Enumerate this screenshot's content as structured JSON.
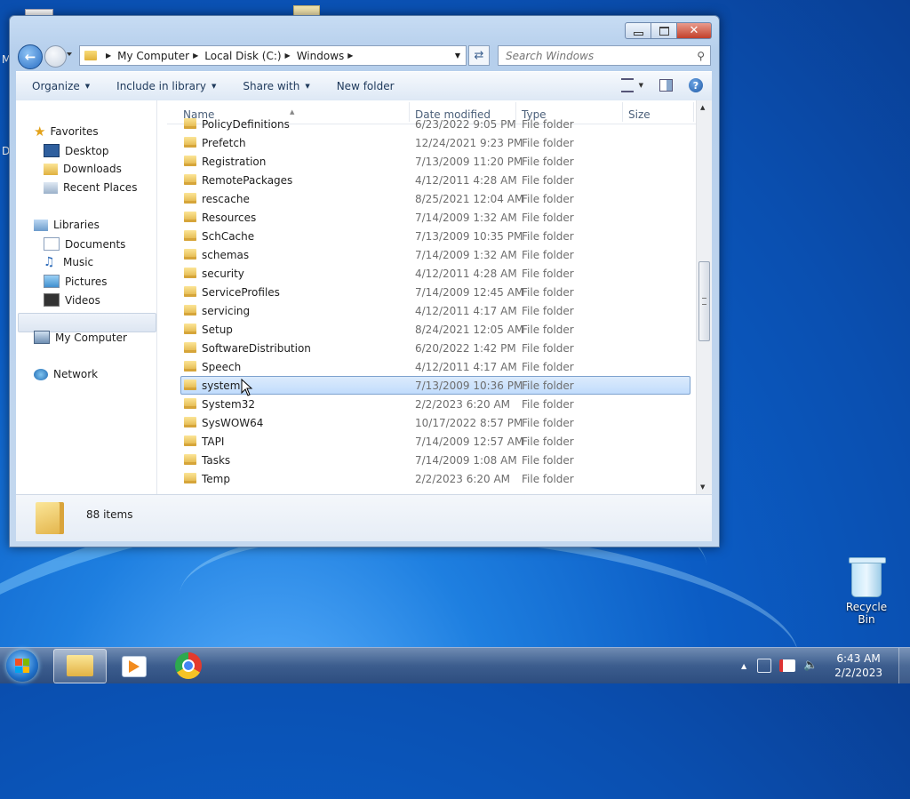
{
  "desktop": {
    "edge_letter_1": "M",
    "edge_letter_2": "D",
    "recycle_bin": "Recycle Bin"
  },
  "window": {
    "close_glyph": "✕",
    "address": {
      "crumbs": [
        "My Computer",
        "Local Disk (C:)",
        "Windows"
      ]
    },
    "search_placeholder": "Search Windows",
    "toolbar": {
      "organize": "Organize",
      "include": "Include in library",
      "share": "Share with",
      "new_folder": "New folder"
    },
    "nav": {
      "favorites": "Favorites",
      "desktop": "Desktop",
      "downloads": "Downloads",
      "recent": "Recent Places",
      "libraries": "Libraries",
      "documents": "Documents",
      "music": "Music",
      "pictures": "Pictures",
      "videos": "Videos",
      "computer": "My Computer",
      "network": "Network"
    },
    "columns": {
      "name": "Name",
      "date": "Date modified",
      "type": "Type",
      "size": "Size"
    },
    "rows": [
      {
        "name": "PolicyDefinitions",
        "date": "6/23/2022 9:05 PM",
        "type": "File folder"
      },
      {
        "name": "Prefetch",
        "date": "12/24/2021 9:23 PM",
        "type": "File folder"
      },
      {
        "name": "Registration",
        "date": "7/13/2009 11:20 PM",
        "type": "File folder"
      },
      {
        "name": "RemotePackages",
        "date": "4/12/2011 4:28 AM",
        "type": "File folder"
      },
      {
        "name": "rescache",
        "date": "8/25/2021 12:04 AM",
        "type": "File folder"
      },
      {
        "name": "Resources",
        "date": "7/14/2009 1:32 AM",
        "type": "File folder"
      },
      {
        "name": "SchCache",
        "date": "7/13/2009 10:35 PM",
        "type": "File folder"
      },
      {
        "name": "schemas",
        "date": "7/14/2009 1:32 AM",
        "type": "File folder"
      },
      {
        "name": "security",
        "date": "4/12/2011 4:28 AM",
        "type": "File folder"
      },
      {
        "name": "ServiceProfiles",
        "date": "7/14/2009 12:45 AM",
        "type": "File folder"
      },
      {
        "name": "servicing",
        "date": "4/12/2011 4:17 AM",
        "type": "File folder"
      },
      {
        "name": "Setup",
        "date": "8/24/2021 12:05 AM",
        "type": "File folder"
      },
      {
        "name": "SoftwareDistribution",
        "date": "6/20/2022 1:42 PM",
        "type": "File folder"
      },
      {
        "name": "Speech",
        "date": "4/12/2011 4:17 AM",
        "type": "File folder"
      },
      {
        "name": "system",
        "date": "7/13/2009 10:36 PM",
        "type": "File folder"
      },
      {
        "name": "System32",
        "date": "2/2/2023 6:20 AM",
        "type": "File folder"
      },
      {
        "name": "SysWOW64",
        "date": "10/17/2022 8:57 PM",
        "type": "File folder"
      },
      {
        "name": "TAPI",
        "date": "7/14/2009 12:57 AM",
        "type": "File folder"
      },
      {
        "name": "Tasks",
        "date": "7/14/2009 1:08 AM",
        "type": "File folder"
      },
      {
        "name": "Temp",
        "date": "2/2/2023 6:20 AM",
        "type": "File folder"
      }
    ],
    "selected_row": "system",
    "item_count": "88 items"
  },
  "taskbar": {
    "time": "6:43 AM",
    "date": "2/2/2023"
  },
  "colors": {
    "selection": "#c1dcfc",
    "folder": "#e2b23a",
    "taskbar": "#3c5d8e"
  }
}
